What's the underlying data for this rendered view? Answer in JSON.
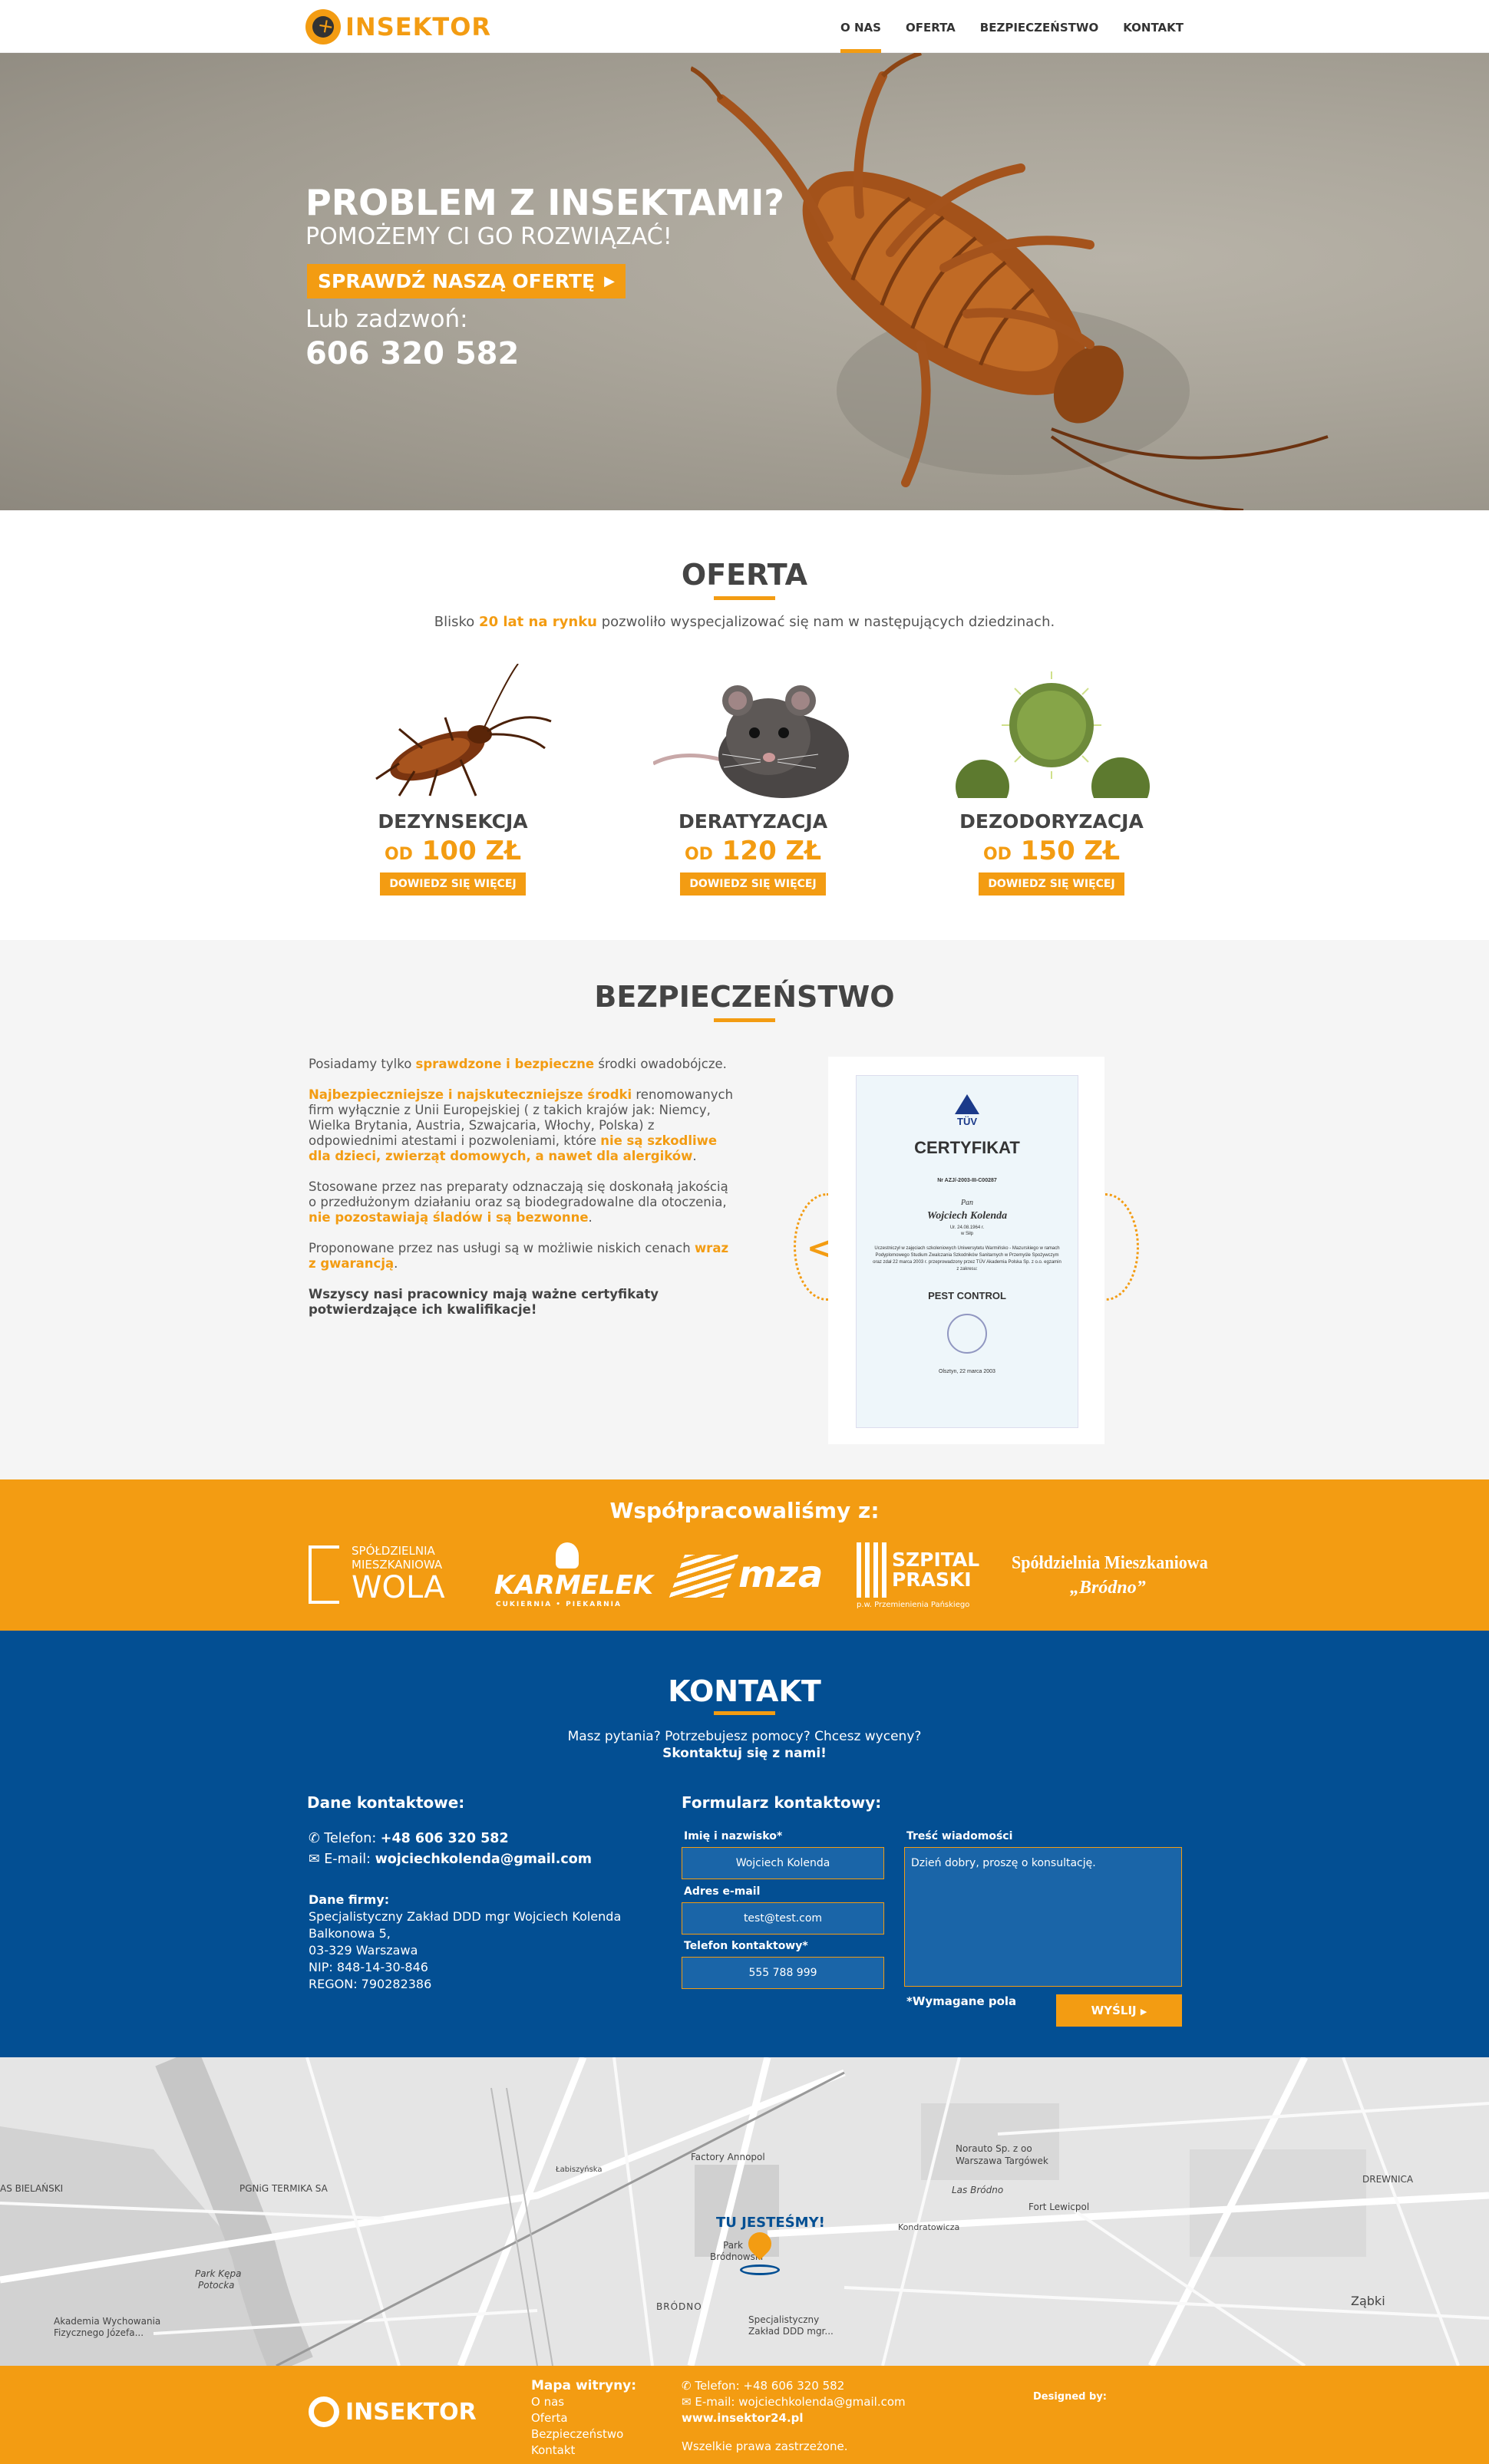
{
  "brand": {
    "name": "INSEKTOR"
  },
  "nav": [
    {
      "label": "O NAS",
      "active": true
    },
    {
      "label": "OFERTA"
    },
    {
      "label": "BEZPIECZEŃSTWO"
    },
    {
      "label": "KONTAKT"
    }
  ],
  "hero": {
    "title": "PROBLEM Z INSEKTAMI?",
    "subtitle": "POMOŻEMY CI GO ROZWIĄZAĆ!",
    "cta": "SPRAWDŹ NASZĄ OFERTĘ",
    "call_label": "Lub zadzwoń:",
    "phone": "606 320 582"
  },
  "oferta": {
    "title": "OFERTA",
    "lead_pre": "Blisko ",
    "lead_hl": "20 lat na rynku",
    "lead_post": " pozwoliło wyspecjalizować się nam w następujących dziedzinach.",
    "items": [
      {
        "name": "DEZYNSEKCJA",
        "price_prefix": "OD",
        "price": "100 ZŁ",
        "button": "DOWIEDZ SIĘ WIĘCEJ"
      },
      {
        "name": "DERATYZACJA",
        "price_prefix": "OD",
        "price": "120 ZŁ",
        "button": "DOWIEDZ SIĘ WIĘCEJ"
      },
      {
        "name": "DEZODORYZACJA",
        "price_prefix": "OD",
        "price": "150 ZŁ",
        "button": "DOWIEDZ SIĘ WIĘCEJ"
      }
    ]
  },
  "bezp": {
    "title": "BEZPIECZEŃSTWO",
    "p1_a": "Posiadamy tylko ",
    "p1_hl": "sprawdzone i bezpieczne",
    "p1_b": " środki owadobójcze.",
    "p2_hl": "Najbezpieczniejsze i najskuteczniejsze środki",
    "p2_a": " renomowanych firm wyłącznie z Unii Europejskiej ( z takich krajów jak: Niemcy, Wielka Brytania, Austria, Szwajcaria, Włochy, Polska) z odpowiednimi atestami i pozwoleniami, które ",
    "p2_hl2": "nie są szkodliwe dla dzieci, zwierząt domowych, a nawet dla alergików",
    "p2_b": ".",
    "p3_a": "Stosowane przez nas preparaty odznaczają się doskonałą jakością o przedłużonym działaniu oraz są biodegradowalne dla otoczenia, ",
    "p3_hl": "nie pozostawiają śladów i są bezwonne",
    "p3_b": ".",
    "p4_a": "Proponowane przez nas usługi są w możliwie niskich cenach ",
    "p4_hl": "wraz z gwarancją",
    "p4_b": ".",
    "p5": "Wszyscy nasi pracownicy mają ważne certyfikaty potwierdzające ich kwalifikacje!",
    "cert": {
      "org": "TÜV",
      "title": "CERTYFIKAT",
      "number": "Nr AZJ/-2003-III-C00287",
      "salutation": "Pan",
      "person": "Wojciech Kolenda",
      "birth": "Ur. 24.08.1964 r.",
      "place": "w Siłp",
      "body": "Uczestniczył w zajęciach szkoleniowych Uniwersytetu Warmińsko - Mazurskiego w ramach Podyplomowego Studium Zwalczania Szkodników Sanitarnych w Przemyśle Spożywczym oraz zdał 22 marca 2003 r. przeprowadzony przez TÜV Akademia Polska Sp. z o.o. egzamin z zakresu:",
      "scope": "PEST CONTROL",
      "date": "Olsztyn, 22 marca 2003"
    }
  },
  "partners": {
    "title": "Współpracowaliśmy z:",
    "logos": [
      {
        "l1": "SPÓŁDZIELNIA",
        "l2": "MIESZKANIOWA",
        "l3": "WOLA"
      },
      {
        "l1": "KARMELEK",
        "l2": "CUKIERNIA • PIEKARNIA"
      },
      {
        "l1": "mza"
      },
      {
        "l1": "SZPITAL",
        "l2": "PRASKI",
        "l3": "p.w. Przemienienia Pańskiego"
      },
      {
        "l1": "Spółdzielnia Mieszkaniowa",
        "l2": "„Bródno”"
      }
    ]
  },
  "kontakt": {
    "title": "KONTAKT",
    "lead1": "Masz pytania? Potrzebujesz pomocy? Chcesz wyceny?",
    "lead2": "Skontaktuj się z nami!",
    "dane_title": "Dane kontaktowe:",
    "phone_label": "Telefon: ",
    "phone": "+48 606 320 582",
    "email_label": "E-mail: ",
    "email": "wojciechkolenda@gmail.com",
    "firm_title": "Dane firmy:",
    "firm_lines": [
      "Specjalistyczny Zakład DDD mgr Wojciech Kolenda",
      "Balkonowa 5,",
      "03-329 Warszawa",
      "NIP: 848-14-30-846",
      "REGON: 790282386"
    ],
    "form_title": "Formularz kontaktowy:",
    "name_label": "Imię i nazwisko*",
    "name_value": "Wojciech Kolenda",
    "email_field_label": "Adres e-mail",
    "email_value": "test@test.com",
    "tel_label": "Telefon kontaktowy*",
    "tel_value": "555 788 999",
    "msg_label": "Treść wiadomości",
    "msg_value": "Dzień dobry, proszę o konsultację.",
    "required": "*Wymagane pola",
    "send": "WYŚLIJ"
  },
  "map": {
    "pin_label": "TU JESTEŚMY!",
    "labels": [
      "Factory Annopol",
      "Norauto Sp. z oo",
      "Warszawa Targówek",
      "Las Bródno",
      "Fort Lewicpol",
      "AS BIELAŃSKI",
      "PGNiG TERMIKA SA",
      "Park Kępa",
      "Potocka",
      "Akademia Wychowania",
      "Fizycznego Józefa...",
      "Specjalistyczny",
      "Zakład DDD mgr...",
      "BRÓDNO",
      "Park",
      "Bródnowski",
      "DREWNICA",
      "Ząbki",
      "Łabiszyńska",
      "Kondratowicza"
    ]
  },
  "footer": {
    "brand": "INSEKTOR",
    "map_title": "Mapa witryny:",
    "links": [
      "O nas",
      "Oferta",
      "Bezpieczeństwo",
      "Kontakt"
    ],
    "phone": "Telefon: +48 606 320 582",
    "email": "E-mail: wojciechkolenda@gmail.com",
    "www": "www.insektor24.pl",
    "rights": "Wszelkie prawa zastrzeżone.",
    "designed": "Designed by:"
  },
  "colors": {
    "accent": "#f39c12",
    "blue": "#034f93",
    "text": "#555555"
  }
}
